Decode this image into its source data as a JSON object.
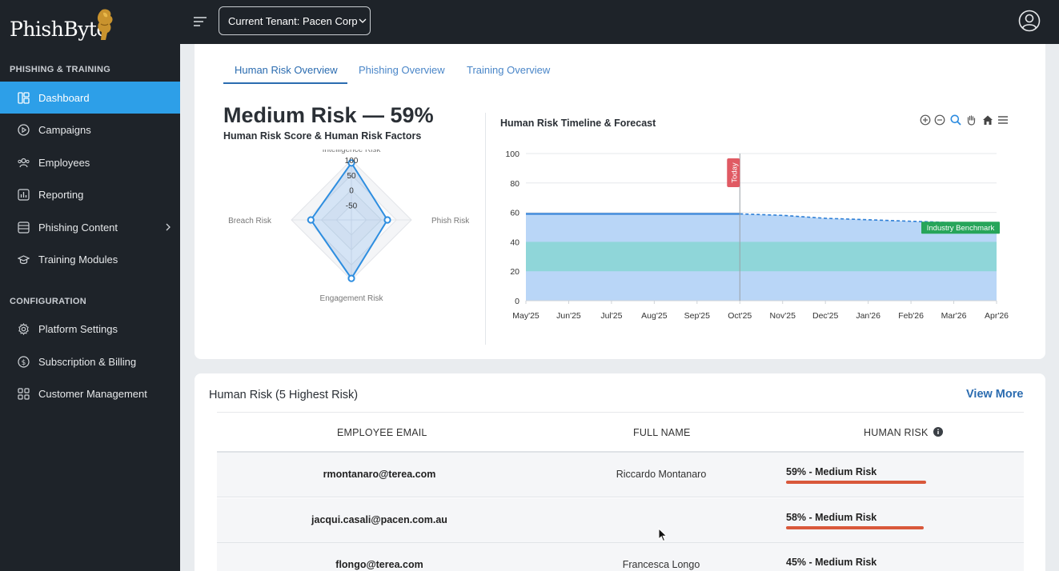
{
  "brand": {
    "name": "PhishByte"
  },
  "header": {
    "tenant_label": "Current Tenant: Pacen Corp"
  },
  "sidebar": {
    "section1": "PHISHING & TRAINING",
    "section2": "CONFIGURATION",
    "items": [
      {
        "label": "Dashboard",
        "icon": "dashboard-icon"
      },
      {
        "label": "Campaigns",
        "icon": "play-circle-icon"
      },
      {
        "label": "Employees",
        "icon": "users-icon"
      },
      {
        "label": "Reporting",
        "icon": "chart-icon"
      },
      {
        "label": "Phishing Content",
        "icon": "inbox-icon"
      },
      {
        "label": "Training Modules",
        "icon": "graduation-cap-icon"
      },
      {
        "label": "Platform Settings",
        "icon": "gear-icon"
      },
      {
        "label": "Subscription & Billing",
        "icon": "dollar-circle-icon"
      },
      {
        "label": "Customer Management",
        "icon": "grid-icon"
      }
    ]
  },
  "tabs": [
    "Human Risk Overview",
    "Phishing Overview",
    "Training Overview"
  ],
  "overview": {
    "risk_title": "Medium Risk — 59%",
    "risk_subtitle": "Human Risk Score & Human Risk Factors"
  },
  "radar": {
    "axes": [
      "Intelligence Risk",
      "Phish Risk",
      "Engagement Risk",
      "Breach Risk"
    ],
    "values": [
      90,
      20,
      95,
      35
    ],
    "ticks": [
      100,
      50,
      0,
      -50
    ]
  },
  "chart_data": {
    "type": "area",
    "title": "Human Risk Timeline & Forecast",
    "x": [
      "May'25",
      "Jun'25",
      "Jul'25",
      "Aug'25",
      "Sep'25",
      "Oct'25",
      "Nov'25",
      "Dec'25",
      "Jan'26",
      "Feb'26",
      "Mar'26",
      "Apr'26"
    ],
    "ylim": [
      0,
      100
    ],
    "yticks": [
      0,
      20,
      40,
      60,
      80,
      100
    ],
    "series": [
      {
        "values": [
          59,
          59,
          59,
          59,
          59,
          59,
          null,
          null,
          null,
          null,
          null,
          null
        ],
        "style": "solid",
        "color": "#2e7fd6"
      },
      {
        "values": [
          null,
          null,
          null,
          null,
          null,
          59,
          58,
          56,
          55,
          54,
          53,
          53
        ],
        "style": "dashed",
        "color": "#2e7fd6"
      }
    ],
    "bands": [
      {
        "from": 0,
        "to": 20,
        "color": "#b9d6f7"
      },
      {
        "from": 20,
        "to": 40,
        "color": "#8fd6d9"
      }
    ],
    "annotations": [
      {
        "text": "Today",
        "x": "Oct'25",
        "color": "#e05a63"
      },
      {
        "text": "Industry Benchmark",
        "x": "Apr'26",
        "y": 45,
        "color": "#27a55a"
      }
    ],
    "grid": true
  },
  "top_risk": {
    "title": "Human Risk (5 Highest Risk)",
    "view_more": "View More",
    "columns": [
      "EMPLOYEE EMAIL",
      "FULL NAME",
      "HUMAN RISK"
    ],
    "rows": [
      {
        "email": "rmontanaro@terea.com",
        "name": "Riccardo Montanaro",
        "risk": "59% - Medium Risk",
        "score": 59
      },
      {
        "email": "jacqui.casali@pacen.com.au",
        "name": "",
        "risk": "58% - Medium Risk",
        "score": 58
      },
      {
        "email": "flongo@terea.com",
        "name": "Francesca Longo",
        "risk": "45% - Medium Risk",
        "score": 45
      }
    ]
  }
}
